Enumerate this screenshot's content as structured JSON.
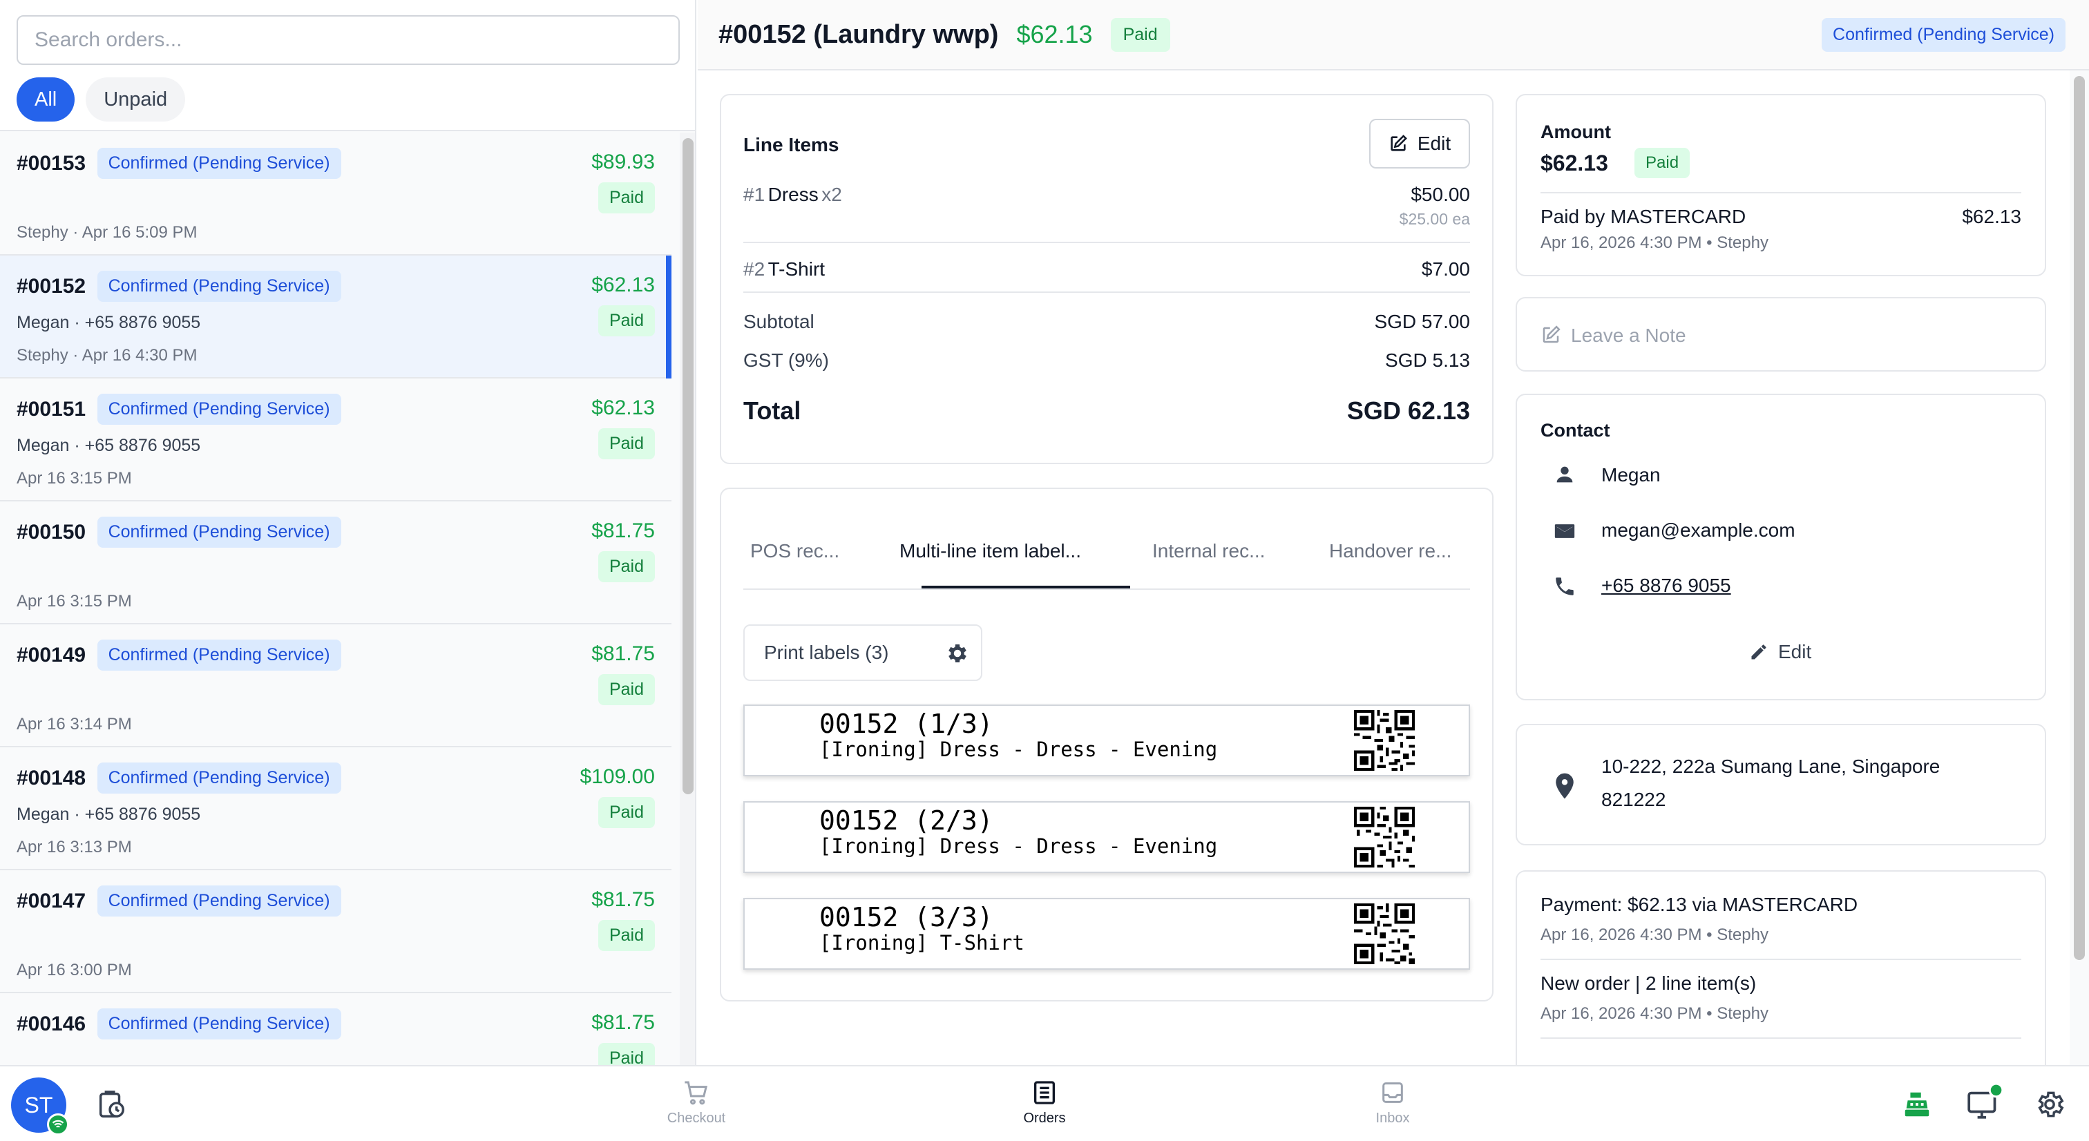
{
  "search": {
    "placeholder": "Search orders..."
  },
  "filters": [
    "All",
    "Unpaid"
  ],
  "orders": [
    {
      "id": "#00153",
      "status": "Confirmed (Pending Service)",
      "amount": "$89.93",
      "paid": "Paid",
      "customer": "",
      "meta": "Stephy · Apr 16 5:09 PM"
    },
    {
      "id": "#00152",
      "status": "Confirmed (Pending Service)",
      "amount": "$62.13",
      "paid": "Paid",
      "customer": "Megan · +65 8876 9055",
      "meta": "Stephy · Apr 16 4:30 PM"
    },
    {
      "id": "#00151",
      "status": "Confirmed (Pending Service)",
      "amount": "$62.13",
      "paid": "Paid",
      "customer": "Megan · +65 8876 9055",
      "meta": "Apr 16 3:15 PM"
    },
    {
      "id": "#00150",
      "status": "Confirmed (Pending Service)",
      "amount": "$81.75",
      "paid": "Paid",
      "customer": "",
      "meta": "Apr 16 3:15 PM"
    },
    {
      "id": "#00149",
      "status": "Confirmed (Pending Service)",
      "amount": "$81.75",
      "paid": "Paid",
      "customer": "",
      "meta": "Apr 16 3:14 PM"
    },
    {
      "id": "#00148",
      "status": "Confirmed (Pending Service)",
      "amount": "$109.00",
      "paid": "Paid",
      "customer": "Megan · +65 8876 9055",
      "meta": "Apr 16 3:13 PM"
    },
    {
      "id": "#00147",
      "status": "Confirmed (Pending Service)",
      "amount": "$81.75",
      "paid": "Paid",
      "customer": "",
      "meta": "Apr 16 3:00 PM"
    },
    {
      "id": "#00146",
      "status": "Confirmed (Pending Service)",
      "amount": "$81.75",
      "paid": "Paid",
      "customer": "",
      "meta": ""
    }
  ],
  "detail": {
    "title": "#00152 (Laundry wwp)",
    "total": "$62.13",
    "paid": "Paid",
    "status": "Confirmed (Pending Service)"
  },
  "line_items": {
    "title": "Line Items",
    "edit_label": "Edit",
    "items": [
      {
        "num": "#1",
        "name": "Dress",
        "qty": "x2",
        "price": "$50.00",
        "each": "$25.00 ea"
      },
      {
        "num": "#2",
        "name": "T-Shirt",
        "qty": "",
        "price": "$7.00",
        "each": ""
      }
    ],
    "subtotal_label": "Subtotal",
    "subtotal": "SGD 57.00",
    "gst_label": "GST (9%)",
    "gst": "SGD 5.13",
    "total_label": "Total",
    "total": "SGD 62.13"
  },
  "print": {
    "tabs": [
      "POS rec...",
      "Multi-line item label...",
      "Internal rec...",
      "Handover re..."
    ],
    "active_tab": 1,
    "print_button": "Print labels (3)",
    "labels": [
      {
        "code": "00152 (1/3)",
        "desc": "[Ironing] Dress - Dress - Evening"
      },
      {
        "code": "00152 (2/3)",
        "desc": "[Ironing] Dress - Dress - Evening"
      },
      {
        "code": "00152 (3/3)",
        "desc": "[Ironing] T-Shirt"
      }
    ]
  },
  "amount": {
    "title": "Amount",
    "value": "$62.13",
    "paid": "Paid",
    "paid_by": "Paid by MASTERCARD",
    "paid_amount": "$62.13",
    "paid_meta": "Apr 16, 2026 4:30 PM • Stephy"
  },
  "note": {
    "placeholder": "Leave a Note"
  },
  "contact": {
    "title": "Contact",
    "name": "Megan",
    "email": "megan@example.com",
    "phone": "+65 8876 9055",
    "edit_label": "Edit"
  },
  "address": {
    "line1": "10-222, 222a Sumang Lane, Singapore",
    "line2": "821222"
  },
  "activity": [
    {
      "text": "Payment: $62.13 via MASTERCARD",
      "meta": "Apr 16, 2026 4:30 PM • Stephy"
    },
    {
      "text": "New order | 2 line item(s)",
      "meta": "Apr 16, 2026 4:30 PM • Stephy"
    }
  ],
  "bottom_nav": {
    "avatar": "ST",
    "items": [
      "Checkout",
      "Orders",
      "Inbox"
    ],
    "active": "Orders"
  },
  "colors": {
    "accent": "#2563eb",
    "paid_green": "#16a34a",
    "status_blue": "#1d4ed8"
  }
}
